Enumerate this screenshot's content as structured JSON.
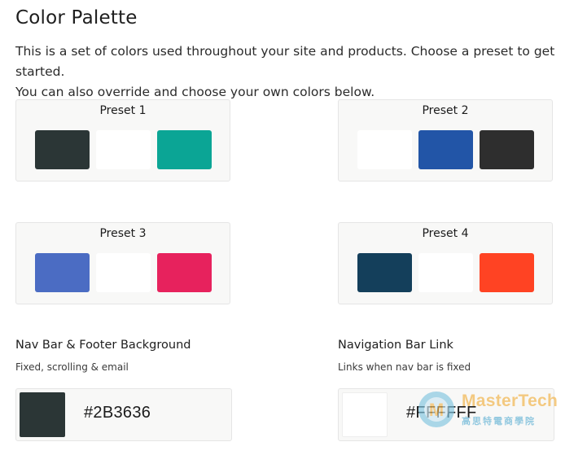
{
  "header": {
    "title": "Color Palette",
    "description_line1": "This is a set of colors used throughout your site and products. Choose a preset to get started.",
    "description_line2": "You can also override and choose your own colors below."
  },
  "presets": [
    {
      "label": "Preset 1",
      "colors": [
        "#2B3636",
        "#FFFFFF",
        "#0BA595"
      ]
    },
    {
      "label": "Preset 2",
      "colors": [
        "#FFFFFF",
        "#2255A7",
        "#2E2E2E"
      ]
    },
    {
      "label": "Preset 3",
      "colors": [
        "#4B6CC3",
        "#FFFFFF",
        "#E7225D"
      ]
    },
    {
      "label": "Preset 4",
      "colors": [
        "#143F5B",
        "#FFFFFF",
        "#FF4323"
      ]
    }
  ],
  "nav_footer_bg": {
    "label": "Nav Bar & Footer Background",
    "sub": "Fixed, scrolling & email",
    "value": "#2B3636"
  },
  "nav_link": {
    "label": "Navigation Bar Link",
    "sub": "Links when nav bar is fixed",
    "value": "#FFFFFF"
  },
  "watermark": {
    "brand": "MasterTech",
    "sub": "高思特電商學院",
    "logo_letter": "M"
  }
}
